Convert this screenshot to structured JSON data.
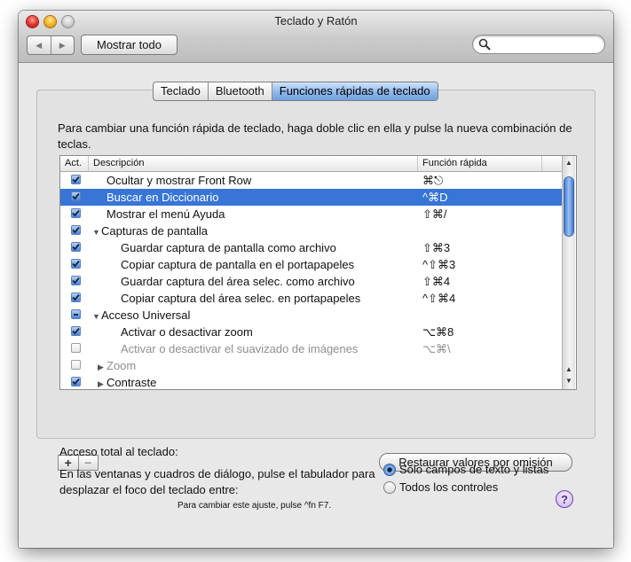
{
  "window": {
    "title": "Teclado y Ratón",
    "back_icon": "back-arrow-icon",
    "forward_icon": "forward-arrow-icon",
    "show_all_label": "Mostrar todo",
    "search_placeholder": "",
    "search_icon": "magnifier-icon"
  },
  "tabs": [
    {
      "label": "Teclado",
      "active": false
    },
    {
      "label": "Bluetooth",
      "active": false
    },
    {
      "label": "Funciones rápidas de teclado",
      "active": true
    }
  ],
  "instructions": "Para cambiar una función rápida de teclado, haga doble clic en ella y pulse la nueva combinación de teclas.",
  "table": {
    "headers": {
      "active": "Act.",
      "description": "Descripción",
      "shortcut": "Función rápida"
    },
    "rows": [
      {
        "checked": "on",
        "label": "Ocultar y mostrar Front Row",
        "shortcut": "⌘⎋",
        "indent": 1,
        "disclosure": "",
        "selected": false,
        "disabled": false
      },
      {
        "checked": "on",
        "label": "Buscar en Diccionario",
        "shortcut": "^⌘D",
        "indent": 1,
        "disclosure": "",
        "selected": true,
        "disabled": false
      },
      {
        "checked": "on",
        "label": "Mostrar el menú Ayuda",
        "shortcut": "⇧⌘/",
        "indent": 1,
        "disclosure": "",
        "selected": false,
        "disabled": false
      },
      {
        "checked": "on",
        "label": "Capturas de pantalla",
        "shortcut": "",
        "indent": 0,
        "disclosure": "▼",
        "selected": false,
        "disabled": false
      },
      {
        "checked": "on",
        "label": "Guardar captura de pantalla como archivo",
        "shortcut": "⇧⌘3",
        "indent": 2,
        "disclosure": "",
        "selected": false,
        "disabled": false
      },
      {
        "checked": "on",
        "label": "Copiar captura de pantalla en el portapapeles",
        "shortcut": "^⇧⌘3",
        "indent": 2,
        "disclosure": "",
        "selected": false,
        "disabled": false
      },
      {
        "checked": "on",
        "label": "Guardar captura del área selec. como archivo",
        "shortcut": "⇧⌘4",
        "indent": 2,
        "disclosure": "",
        "selected": false,
        "disabled": false
      },
      {
        "checked": "on",
        "label": "Copiar captura del área selec. en portapapeles",
        "shortcut": "^⇧⌘4",
        "indent": 2,
        "disclosure": "",
        "selected": false,
        "disabled": false
      },
      {
        "checked": "mixed",
        "label": "Acceso Universal",
        "shortcut": "",
        "indent": 0,
        "disclosure": "▼",
        "selected": false,
        "disabled": false
      },
      {
        "checked": "on",
        "label": "Activar o desactivar zoom",
        "shortcut": "⌥⌘8",
        "indent": 2,
        "disclosure": "",
        "selected": false,
        "disabled": false
      },
      {
        "checked": "off",
        "label": "Activar o desactivar el suavizado de imágenes",
        "shortcut": "⌥⌘\\",
        "indent": 2,
        "disclosure": "",
        "selected": false,
        "disabled": true
      },
      {
        "checked": "off",
        "label": "Zoom",
        "shortcut": "",
        "indent": 1,
        "disclosure": "▶",
        "selected": false,
        "disabled": true
      },
      {
        "checked": "on",
        "label": "Contraste",
        "shortcut": "",
        "indent": 1,
        "disclosure": "▶",
        "selected": false,
        "disabled": false
      }
    ]
  },
  "buttons": {
    "add_label": "+",
    "remove_label": "−",
    "restore_label": "Restaurar valores por omisión"
  },
  "keyboard_access": {
    "title": "Acceso total al teclado:",
    "description": "En las ventanas y cuadros de diálogo, pulse el tabulador para desplazar el foco del teclado entre:",
    "options": [
      {
        "label": "Sólo campos de texto y listas",
        "selected": true
      },
      {
        "label": "Todos los controles",
        "selected": false
      }
    ],
    "hint": "Para cambiar este ajuste, pulse ^fn F7.",
    "help_label": "?"
  },
  "colors": {
    "selection": "#3875d7",
    "tab_active": "#8fb7ea",
    "window_bg": "#e8e8e8"
  }
}
